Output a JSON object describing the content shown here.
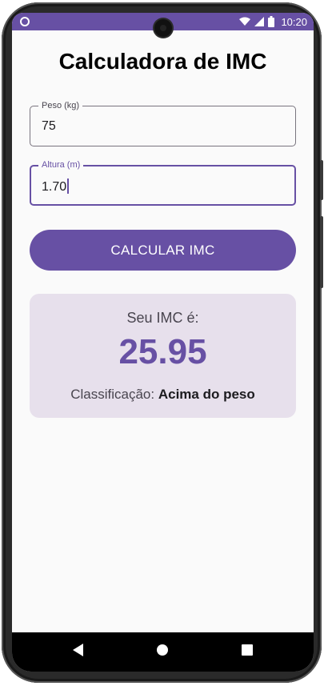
{
  "status_bar": {
    "time": "10:20"
  },
  "app": {
    "title": "Calculadora de IMC"
  },
  "form": {
    "weight": {
      "label": "Peso (kg)",
      "value": "75"
    },
    "height": {
      "label": "Altura (m)",
      "value": "1.70"
    },
    "calculate_label": "CALCULAR IMC"
  },
  "result": {
    "heading": "Seu IMC é:",
    "value": "25.95",
    "classification_prefix": "Classificação:",
    "classification": "Acima do peso"
  },
  "colors": {
    "primary": "#6750a4",
    "card_background": "#e7e0ec",
    "screen_background": "#fafafa"
  },
  "icons": {
    "status": [
      "notification-dot-icon",
      "wifi-icon",
      "cell-signal-icon",
      "battery-icon"
    ],
    "navigation": [
      "back-icon",
      "home-icon",
      "recents-icon"
    ]
  }
}
